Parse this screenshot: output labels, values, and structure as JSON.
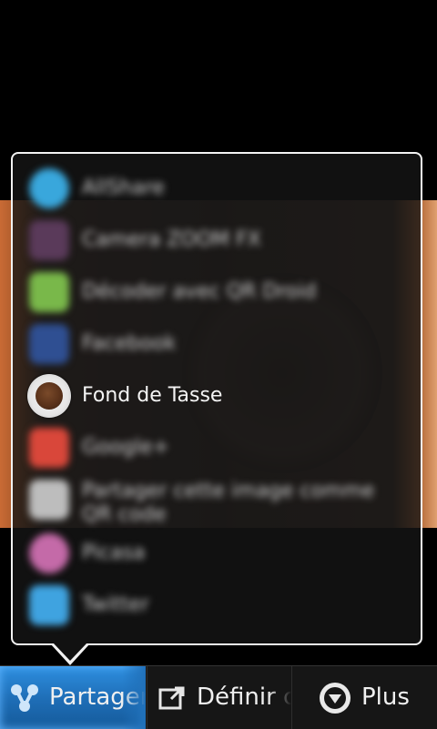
{
  "share_menu": {
    "items": [
      {
        "label": "AllShare",
        "icon": "allshare-icon",
        "color": "#39a7dc",
        "focused": false
      },
      {
        "label": "Camera ZOOM FX",
        "icon": "camera-zoom-fx-icon",
        "color": "#5a3a5a",
        "focused": false
      },
      {
        "label": "Décoder avec QR Droid",
        "icon": "qr-droid-icon",
        "color": "#79b84a",
        "focused": false
      },
      {
        "label": "Facebook",
        "icon": "facebook-icon",
        "color": "#2f4f92",
        "focused": false
      },
      {
        "label": "Fond de Tasse",
        "icon": "coffee-cup-icon",
        "color": "#6a3b1f",
        "focused": true
      },
      {
        "label": "Google+",
        "icon": "google-plus-icon",
        "color": "#d9473a",
        "focused": false
      },
      {
        "label": "Partager cette image comme QR code",
        "icon": "qr-share-icon",
        "color": "#bdbdbd",
        "focused": false
      },
      {
        "label": "Picasa",
        "icon": "picasa-icon",
        "color": "#c46aa8",
        "focused": false
      },
      {
        "label": "Twitter",
        "icon": "twitter-icon",
        "color": "#3fa3e0",
        "focused": false
      }
    ]
  },
  "action_bar": {
    "share_label": "Partager",
    "wallpaper_label": "Définir c",
    "more_label": "Plus"
  }
}
